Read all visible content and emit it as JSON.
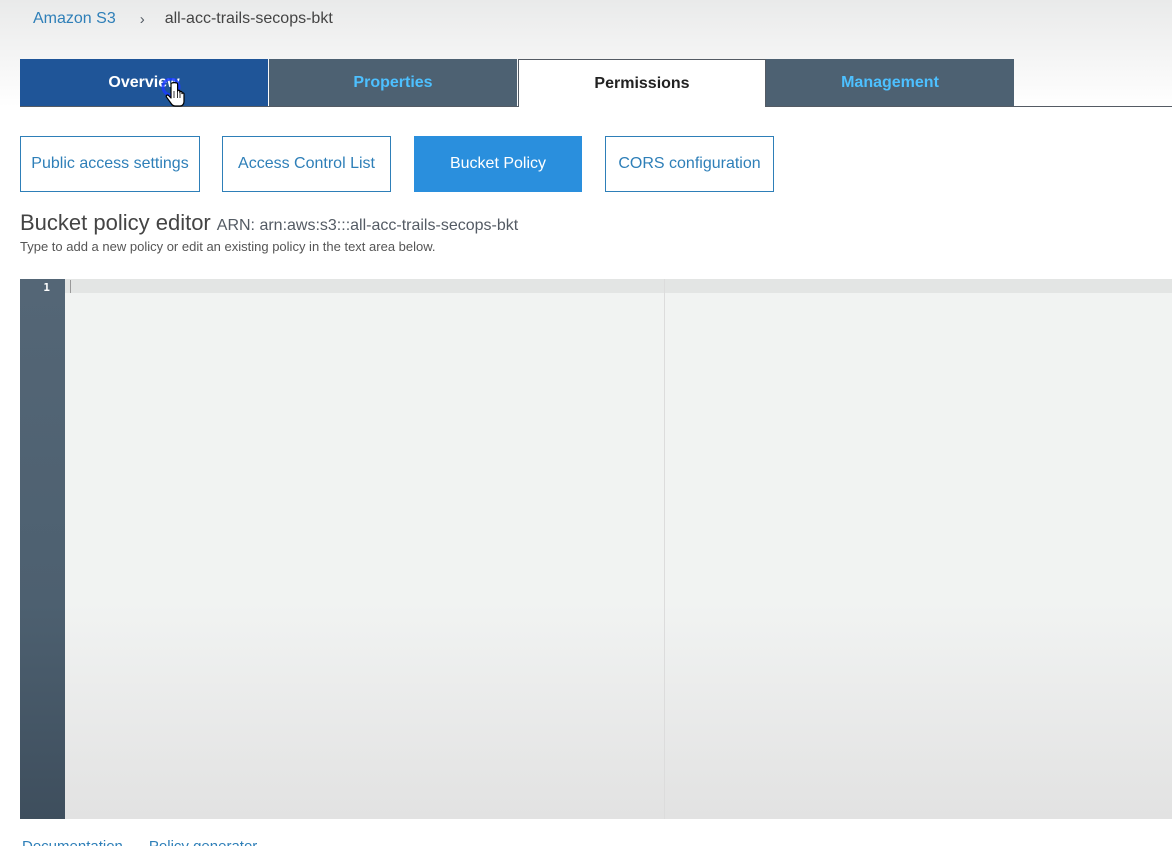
{
  "breadcrumb": {
    "root": "Amazon S3",
    "current": "all-acc-trails-secops-bkt"
  },
  "tabs": [
    {
      "label": "Overview"
    },
    {
      "label": "Properties"
    },
    {
      "label": "Permissions"
    },
    {
      "label": "Management"
    }
  ],
  "active_tab": "Permissions",
  "subtabs": [
    {
      "label": "Public access settings"
    },
    {
      "label": "Access Control List"
    },
    {
      "label": "Bucket Policy"
    },
    {
      "label": "CORS configuration"
    }
  ],
  "active_subtab": "Bucket Policy",
  "editor": {
    "title": "Bucket policy editor",
    "arn": "ARN: arn:aws:s3:::all-acc-trails-secops-bkt",
    "help": "Type to add a new policy or edit an existing policy in the text area below.",
    "line_numbers": [
      "1"
    ],
    "content": ""
  },
  "footer": {
    "links": [
      "Documentation",
      "Policy generator"
    ]
  },
  "colors": {
    "link": "#2e7fb8",
    "active_subtab": "#2a8fdd",
    "tab_overview": "#1f5598",
    "tab_inactive": "#4d6172",
    "tab_inactive_text": "#4dc0ff",
    "gutter": "#546676"
  },
  "icons": {
    "breadcrumb_separator": "chevron-right-icon",
    "cursor": "hand-pointer-icon"
  }
}
